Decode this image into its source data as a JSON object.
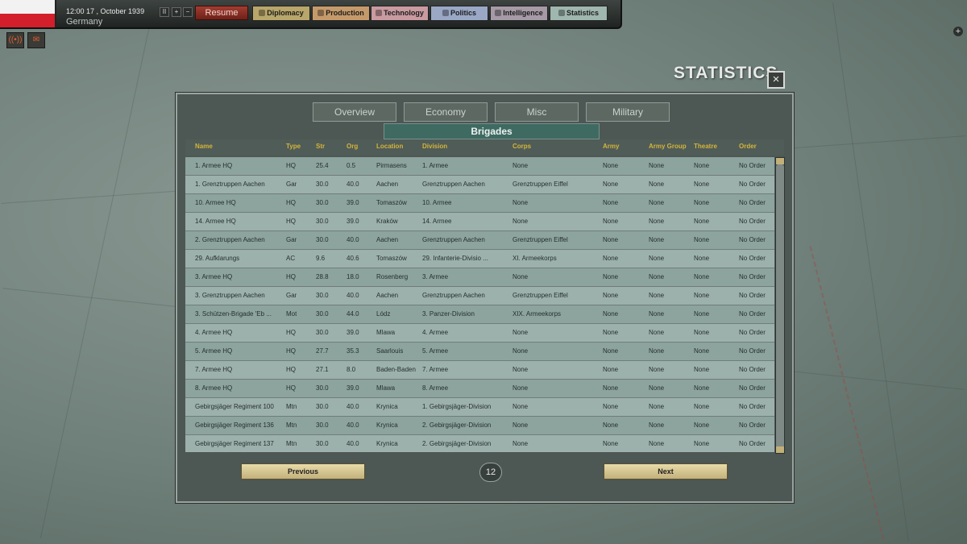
{
  "topbar": {
    "datetime": "12:00 17 , October 1939",
    "country": "Germany",
    "controls": [
      "II",
      "+",
      "−"
    ],
    "resume_label": "Resume",
    "tabs": [
      {
        "label": "Diplomacy",
        "color": "#b8a66a"
      },
      {
        "label": "Production",
        "color": "#c59a6a"
      },
      {
        "label": "Technology",
        "color": "#c99aa0"
      },
      {
        "label": "Politics",
        "color": "#9aa8c6"
      },
      {
        "label": "Intelligence",
        "color": "#a59aa6"
      },
      {
        "label": "Statistics",
        "color": "#9fb7ae"
      }
    ]
  },
  "screen_title": "STATISTICS",
  "close_label": "×",
  "panel": {
    "tabs": [
      "Overview",
      "Economy",
      "Misc",
      "Military"
    ],
    "section_title": "Brigades",
    "columns": [
      "Name",
      "Type",
      "Str",
      "Org",
      "Location",
      "Division",
      "Corps",
      "Army",
      "Army Group",
      "Theatre",
      "Order"
    ],
    "rows": [
      [
        "1. Armee HQ",
        "HQ",
        "25.4",
        "0.5",
        "Pirmasens",
        "1. Armee",
        "None",
        "None",
        "None",
        "None",
        "No Order"
      ],
      [
        "1. Grenztruppen Aachen",
        "Gar",
        "30.0",
        "40.0",
        "Aachen",
        "Grenztruppen Aachen",
        "Grenztruppen Eiffel",
        "None",
        "None",
        "None",
        "No Order"
      ],
      [
        "10. Armee HQ",
        "HQ",
        "30.0",
        "39.0",
        "Tomaszów",
        "10. Armee",
        "None",
        "None",
        "None",
        "None",
        "No Order"
      ],
      [
        "14. Armee HQ",
        "HQ",
        "30.0",
        "39.0",
        "Kraków",
        "14. Armee",
        "None",
        "None",
        "None",
        "None",
        "No Order"
      ],
      [
        "2. Grenztruppen Aachen",
        "Gar",
        "30.0",
        "40.0",
        "Aachen",
        "Grenztruppen Aachen",
        "Grenztruppen Eiffel",
        "None",
        "None",
        "None",
        "No Order"
      ],
      [
        "29. Aufklarungs",
        "AC",
        "9.6",
        "40.6",
        "Tomaszów",
        "29. Infanterie-Divisio ...",
        "XI. Armeekorps",
        "None",
        "None",
        "None",
        "No Order"
      ],
      [
        "3. Armee HQ",
        "HQ",
        "28.8",
        "18.0",
        "Rosenberg",
        "3. Armee",
        "None",
        "None",
        "None",
        "None",
        "No Order"
      ],
      [
        "3. Grenztruppen Aachen",
        "Gar",
        "30.0",
        "40.0",
        "Aachen",
        "Grenztruppen Aachen",
        "Grenztruppen Eiffel",
        "None",
        "None",
        "None",
        "No Order"
      ],
      [
        "3. Schützen-Brigade 'Eb ...",
        "Mot",
        "30.0",
        "44.0",
        "Lódz",
        "3. Panzer-Division",
        "XIX. Armeekorps",
        "None",
        "None",
        "None",
        "No Order"
      ],
      [
        "4. Armee HQ",
        "HQ",
        "30.0",
        "39.0",
        "Mlawa",
        "4. Armee",
        "None",
        "None",
        "None",
        "None",
        "No Order"
      ],
      [
        "5. Armee HQ",
        "HQ",
        "27.7",
        "35.3",
        "Saarlouis",
        "5. Armee",
        "None",
        "None",
        "None",
        "None",
        "No Order"
      ],
      [
        "7. Armee HQ",
        "HQ",
        "27.1",
        "8.0",
        "Baden-Baden",
        "7. Armee",
        "None",
        "None",
        "None",
        "None",
        "No Order"
      ],
      [
        "8. Armee HQ",
        "HQ",
        "30.0",
        "39.0",
        "Mlawa",
        "8. Armee",
        "None",
        "None",
        "None",
        "None",
        "No Order"
      ],
      [
        "Gebirgsjäger Regiment 100",
        "Mtn",
        "30.0",
        "40.0",
        "Krynica",
        "1. Gebirgsjäger-Division",
        "None",
        "None",
        "None",
        "None",
        "No Order"
      ],
      [
        "Gebirgsjäger Regiment 136",
        "Mtn",
        "30.0",
        "40.0",
        "Krynica",
        "2. Gebirgsjäger-Division",
        "None",
        "None",
        "None",
        "None",
        "No Order"
      ],
      [
        "Gebirgsjäger Regiment 137",
        "Mtn",
        "30.0",
        "40.0",
        "Krynica",
        "2. Gebirgsjäger-Division",
        "None",
        "None",
        "None",
        "None",
        "No Order"
      ]
    ],
    "prev_label": "Previous",
    "next_label": "Next",
    "page_number": "12"
  }
}
